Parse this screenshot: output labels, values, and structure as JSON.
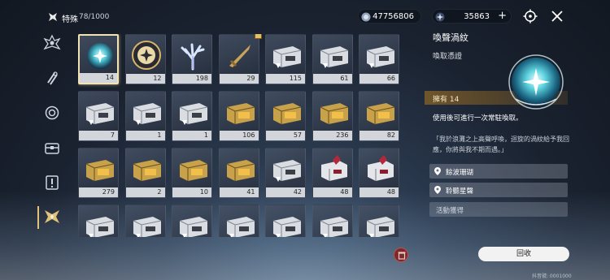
{
  "header": {
    "category_label": "特殊",
    "category_count": "78/1000",
    "currency1_value": "47756806",
    "currency2_value": "35863",
    "plus_label": "+"
  },
  "grid": {
    "items": [
      {
        "count": "14",
        "kind": "orb",
        "selected": true
      },
      {
        "count": "12",
        "kind": "gold-orb"
      },
      {
        "count": "198",
        "kind": "coral"
      },
      {
        "count": "29",
        "kind": "dagger",
        "badge": true
      },
      {
        "count": "115",
        "kind": "silver-chest"
      },
      {
        "count": "61",
        "kind": "silver-chest"
      },
      {
        "count": "66",
        "kind": "silver-chest"
      },
      {
        "count": "7",
        "kind": "silver-chest"
      },
      {
        "count": "1",
        "kind": "silver-chest"
      },
      {
        "count": "1",
        "kind": "silver-chest"
      },
      {
        "count": "106",
        "kind": "gold-chest"
      },
      {
        "count": "57",
        "kind": "gold-chest"
      },
      {
        "count": "236",
        "kind": "gold-chest"
      },
      {
        "count": "82",
        "kind": "gold-chest"
      },
      {
        "count": "279",
        "kind": "gold-chest"
      },
      {
        "count": "2",
        "kind": "gold-chest"
      },
      {
        "count": "10",
        "kind": "gold-chest"
      },
      {
        "count": "41",
        "kind": "gold-chest"
      },
      {
        "count": "42",
        "kind": "silver-chest"
      },
      {
        "count": "48",
        "kind": "red-chest"
      },
      {
        "count": "48",
        "kind": "red-chest"
      },
      {
        "count": "",
        "kind": "silver-chest"
      },
      {
        "count": "",
        "kind": "silver-chest"
      },
      {
        "count": "",
        "kind": "silver-chest"
      },
      {
        "count": "",
        "kind": "silver-chest"
      },
      {
        "count": "",
        "kind": "silver-chest"
      },
      {
        "count": "",
        "kind": "silver-chest"
      },
      {
        "count": "",
        "kind": "silver-chest"
      }
    ]
  },
  "detail": {
    "title": "喚聲渦紋",
    "subtitle": "喚取憑證",
    "owned": "擁有 14",
    "description": "使用後可進行一次常駐喚取。",
    "quote": "「我於浪灘之上高聲呼喚，迴旋的渦紋給予我回應，你將與我不期而遇。」",
    "sources": [
      "餘波珊瑚",
      "聆聽星聲"
    ],
    "activity_label": "活動獲得",
    "recycle_label": "回收"
  },
  "footer": {
    "text": "抖音號: 0001000"
  },
  "colors": {
    "accent_gold": "#e2c17a",
    "owned_bar": "#785a28",
    "count_bg": "#e1e4e8"
  }
}
